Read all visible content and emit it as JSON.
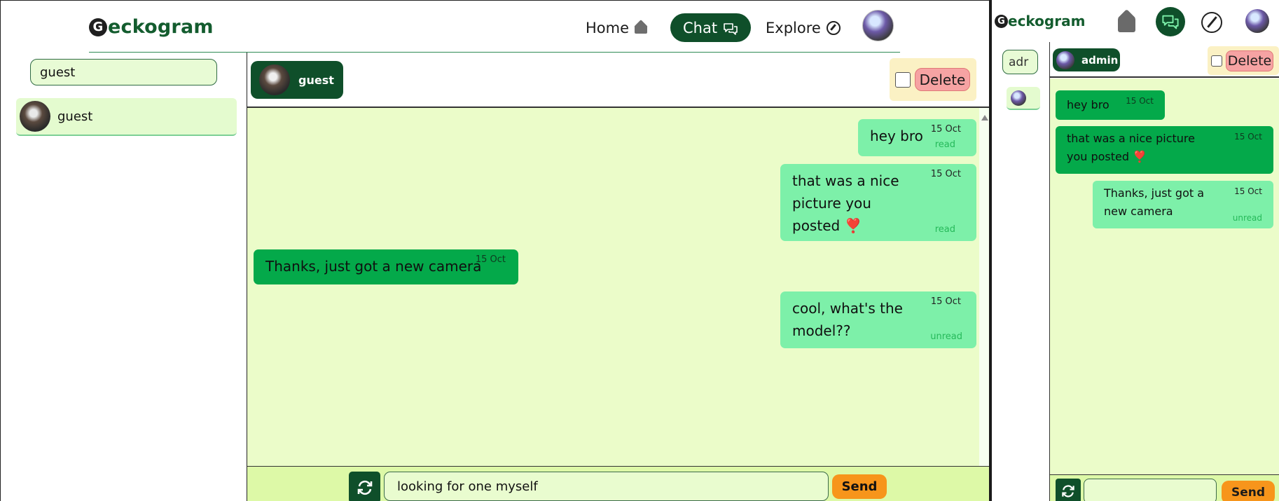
{
  "left": {
    "header": {
      "logo_initial": "G",
      "logo_text": "eckogram",
      "nav": [
        {
          "label": "Home",
          "icon": "home-icon"
        },
        {
          "label": "Chat",
          "icon": "chat-icon",
          "active": true
        },
        {
          "label": "Explore",
          "icon": "compass-icon"
        }
      ]
    },
    "sidebar": {
      "search_value": "guest",
      "contacts": [
        {
          "name": "guest"
        }
      ]
    },
    "chat": {
      "user": "guest",
      "delete_label": "Delete",
      "messages": [
        {
          "from": "me",
          "text": "hey bro",
          "date": "15 Oct",
          "status": "read"
        },
        {
          "from": "me",
          "text": "that was a nice picture you posted",
          "emoji": "❣️",
          "date": "15 Oct",
          "status": "read"
        },
        {
          "from": "them",
          "text": "Thanks, just got a new camera",
          "date": "15 Oct"
        },
        {
          "from": "me",
          "text": "cool, what's the model??",
          "date": "15 Oct",
          "status": "unread"
        }
      ],
      "input_value": "looking for one myself",
      "send_label": "Send"
    }
  },
  "right": {
    "header": {
      "logo_initial": "G",
      "logo_text": "eckogram"
    },
    "sidebar": {
      "search_value": "adr"
    },
    "chat": {
      "user": "admin",
      "delete_label": "Delete",
      "messages": [
        {
          "from": "them",
          "text": "hey bro",
          "date": "15 Oct"
        },
        {
          "from": "them",
          "text": "that was a nice picture you posted",
          "emoji": "❣️",
          "date": "15 Oct"
        },
        {
          "from": "me",
          "text": "Thanks, just got a new camera",
          "date": "15 Oct",
          "status": "unread"
        }
      ],
      "input_value": "",
      "send_label": "Send"
    }
  },
  "colors": {
    "brand_dark_green": "#0f4f2a",
    "chat_background": "#ebfcc9",
    "sent_bubble": "#7df0a9",
    "received_bubble": "#04a94a",
    "send_button": "#f7951b",
    "delete_button": "#f6a3a3"
  }
}
